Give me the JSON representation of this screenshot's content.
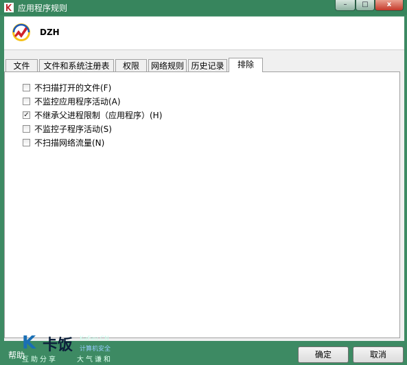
{
  "window": {
    "title": "应用程序规则",
    "minimize": "–",
    "maximize": "□",
    "close": "x"
  },
  "app": {
    "name": "DZH"
  },
  "tabs": [
    {
      "label": "文件"
    },
    {
      "label": "文件和系统注册表"
    },
    {
      "label": "权限"
    },
    {
      "label": "网络规则"
    },
    {
      "label": "历史记录"
    },
    {
      "label": "排除"
    }
  ],
  "active_tab": "排除",
  "options": [
    {
      "label": "不扫描打开的文件(F)",
      "checked": false
    },
    {
      "label": "不监控应用程序活动(A)",
      "checked": false
    },
    {
      "label": "不继承父进程限制（应用程序）(H)",
      "checked": true
    },
    {
      "label": "不监控子程序活动(S)",
      "checked": false
    },
    {
      "label": "不扫描网络流量(N)",
      "checked": false
    }
  ],
  "footer": {
    "help": "帮助",
    "ok": "确定",
    "cancel": "取消"
  },
  "watermark": {
    "brand_k": "K",
    "brand_cn": "卡饭",
    "site": "KaFan.CN",
    "subtitle": "计算机安全",
    "slogan_left": "互助分享",
    "slogan_right": "大气谦和"
  }
}
